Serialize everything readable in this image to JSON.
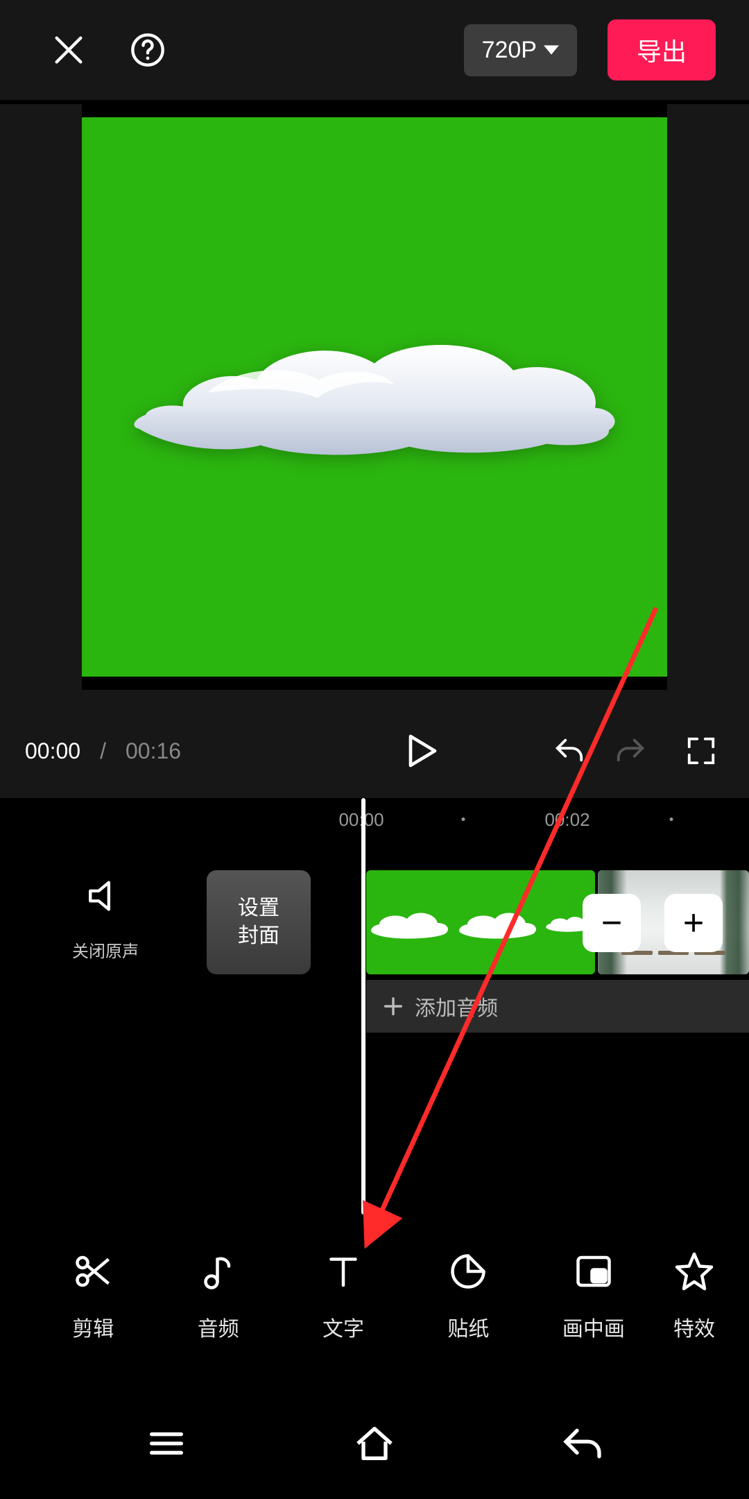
{
  "header": {
    "resolution_label": "720P",
    "export_label": "导出"
  },
  "player": {
    "current_time": "00:00",
    "duration": "00:16"
  },
  "ruler": {
    "ticks": [
      "00:00",
      "00:02"
    ]
  },
  "mute": {
    "label": "关闭原声"
  },
  "cover": {
    "line1": "设置",
    "line2": "封面"
  },
  "audio_track": {
    "add_label": "添加音频"
  },
  "toolbar": {
    "items": [
      {
        "label": "剪辑"
      },
      {
        "label": "音频"
      },
      {
        "label": "文字"
      },
      {
        "label": "贴纸"
      },
      {
        "label": "画中画"
      },
      {
        "label": "特效"
      }
    ]
  },
  "annotation": {
    "color": "#ff2a2a"
  }
}
